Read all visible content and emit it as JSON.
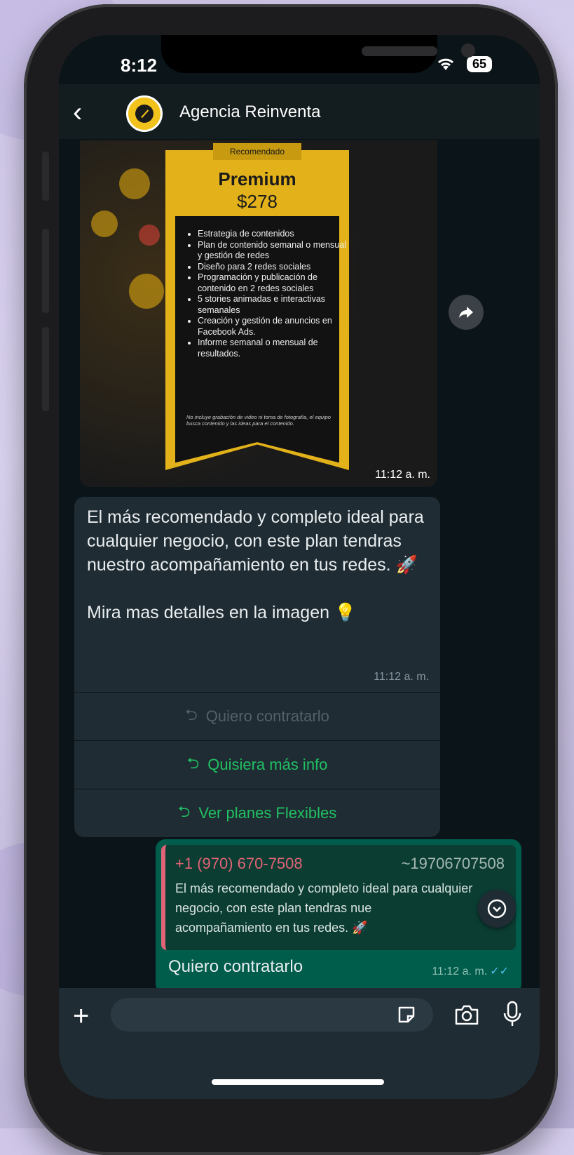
{
  "status": {
    "time": "8:12",
    "battery": "65"
  },
  "header": {
    "title": "Agencia Reinventa"
  },
  "image_message": {
    "badge": "Recomendado",
    "plan_name": "Premium",
    "price": "$278",
    "features": [
      "Estrategia de contenidos",
      "Plan de contenido semanal o mensual y gestión de redes",
      "Diseño  para 2 redes sociales",
      "Programación y publicación de contenido en 2 redes sociales",
      "5 stories animadas e interactivas semanales",
      "Creación y gestión de anuncios en Facebook Ads.",
      "Informe semanal o mensual de resultados."
    ],
    "disclaimer": "No incluye grabación  de video ni toma de fotografía, el equipo busca contenido y las ideas para el contenido.",
    "time": "11:12 a. m."
  },
  "text_message": {
    "text": "El más recomendado y completo ideal para cualquier negocio, con este plan tendras nuestro acompañamiento en tus redes. 🚀\n\nMira mas detalles en la imagen 💡",
    "time": "11:12 a. m."
  },
  "quick_replies": [
    {
      "label": "Quiero contratarlo",
      "state": "disabled"
    },
    {
      "label": "Quisiera más info",
      "state": "active"
    },
    {
      "label": "Ver planes Flexibles",
      "state": "active"
    }
  ],
  "outgoing": {
    "quote_name": "+1 (970) 670-7508",
    "quote_number": "~19706707508",
    "quote_text": "El más recomendado y completo ideal para cualquier negocio, con este plan tendras nue\nacompañamiento en tus redes. 🚀",
    "text": "Quiero contratarlo",
    "time": "11:12 a. m.",
    "ticks": "✓✓"
  },
  "input": {
    "placeholder": ""
  },
  "colors": {
    "accent_green": "#21c063",
    "quote_red": "#e26375",
    "outgoing_bg": "#005c4b",
    "banner_gold": "#e3b21b"
  }
}
